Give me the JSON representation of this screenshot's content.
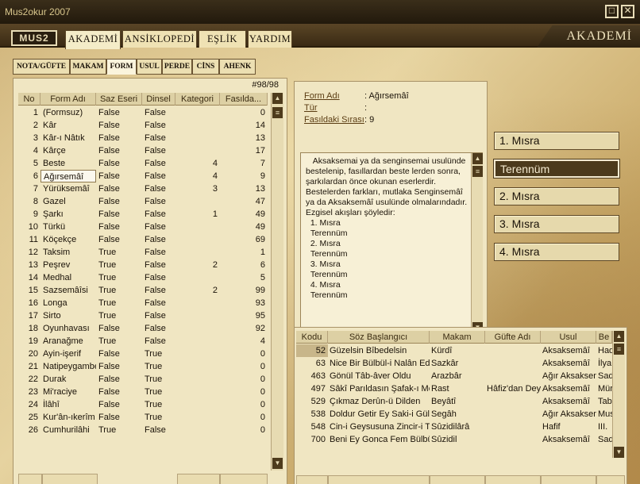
{
  "window": {
    "title": "Mus2okur 2007",
    "max_glyph": "□",
    "close_glyph": "✕"
  },
  "header": {
    "logo": "MUS2",
    "tabs": [
      "AKADEMİ",
      "ANSİKLOPEDİ",
      "EŞLİK",
      "YARDIM"
    ],
    "section_title": "AKADEMİ"
  },
  "subtabs": [
    "NOTA/GÜFTE",
    "MAKAM",
    "FORM",
    "USUL",
    "PERDE",
    "CİNS",
    "AHENK"
  ],
  "form_list": {
    "counter": "#98/98",
    "columns": [
      "No",
      "Form Adı",
      "Saz Eseri",
      "Dinsel",
      "Kategori",
      "Fasılda..."
    ],
    "rows": [
      [
        "1",
        "(Formsuz)",
        "False",
        "False",
        "",
        "0"
      ],
      [
        "2",
        "Kâr",
        "False",
        "False",
        "",
        "14"
      ],
      [
        "3",
        "Kâr-ı Nâtık",
        "False",
        "False",
        "",
        "13"
      ],
      [
        "4",
        "Kârçe",
        "False",
        "False",
        "",
        "17"
      ],
      [
        "5",
        "Beste",
        "False",
        "False",
        "4",
        "7"
      ],
      [
        "6",
        "Ağırsemâî",
        "False",
        "False",
        "4",
        "9"
      ],
      [
        "7",
        "Yürüksemâî",
        "False",
        "False",
        "3",
        "13"
      ],
      [
        "8",
        "Gazel",
        "False",
        "False",
        "",
        "47"
      ],
      [
        "9",
        "Şarkı",
        "False",
        "False",
        "1",
        "49"
      ],
      [
        "10",
        "Türkü",
        "False",
        "False",
        "",
        "49"
      ],
      [
        "11",
        "Köçekçe",
        "False",
        "False",
        "",
        "69"
      ],
      [
        "12",
        "Taksim",
        "True",
        "False",
        "",
        "1"
      ],
      [
        "13",
        "Peşrev",
        "True",
        "False",
        "2",
        "6"
      ],
      [
        "14",
        "Medhal",
        "True",
        "False",
        "",
        "5"
      ],
      [
        "15",
        "Sazsemâîsi",
        "True",
        "False",
        "2",
        "99"
      ],
      [
        "16",
        "Longa",
        "True",
        "False",
        "",
        "93"
      ],
      [
        "17",
        "Sirto",
        "True",
        "False",
        "",
        "95"
      ],
      [
        "18",
        "Oyunhavası",
        "False",
        "False",
        "",
        "92"
      ],
      [
        "19",
        "Aranağme",
        "True",
        "False",
        "",
        "4"
      ],
      [
        "20",
        "Ayin-işerif",
        "False",
        "True",
        "",
        "0"
      ],
      [
        "21",
        "Natipeygambe",
        "False",
        "True",
        "",
        "0"
      ],
      [
        "22",
        "Durak",
        "False",
        "True",
        "",
        "0"
      ],
      [
        "23",
        "Mi'raciye",
        "False",
        "True",
        "",
        "0"
      ],
      [
        "24",
        "İlâhî",
        "False",
        "True",
        "",
        "0"
      ],
      [
        "25",
        "Kur'ân-ıkerîm",
        "False",
        "True",
        "",
        "0"
      ],
      [
        "26",
        "Cumhurilâhi",
        "True",
        "False",
        "",
        "0"
      ]
    ],
    "selected_index": 5
  },
  "form_info": {
    "fields": [
      {
        "label": "Form Adı",
        "value": ": Ağırsemâî"
      },
      {
        "label": "Tür",
        "value": ":"
      },
      {
        "label": "Fasıldaki Sırası",
        "value": ": 9"
      }
    ],
    "description": "   Aksaksemai ya da senginsemai usulünde bestelenip, fasıllardan beste lerden sonra, şarkılardan önce okunan eserlerdir.\nBestelerden farkları, mutlaka Senginsemâî ya da Aksaksemâî usulünde olmalarındadır.\nEzgisel akışları şöyledir:\n  1. Mısra\n  Terennüm\n  2. Mısra\n  Terennüm\n  3. Mısra\n  Terennüm\n  4. Mısra\n  Terennüm"
  },
  "sections": {
    "buttons": [
      "1. Mısra",
      "Terennüm",
      "2. Mısra",
      "3. Mısra",
      "4. Mısra"
    ],
    "active_index": 1
  },
  "works": {
    "columns": [
      "Kodu",
      "Söz Başlangıcı",
      "Makam",
      "Güfte Adı",
      "Usul",
      "Be"
    ],
    "rows": [
      [
        "52",
        "Güzelsin Bîbedelsin",
        "Kürdî",
        "",
        "Aksaksemâî",
        "Had"
      ],
      [
        "63",
        "Nice Bir Bülbül-i Nalân Edey",
        "Sazkâr",
        "",
        "Aksaksemâî",
        "İlya"
      ],
      [
        "463",
        "Gönül Tâb-âver Oldu",
        "Arazbâr",
        "",
        "Ağır Aksaksen",
        "Sad"
      ],
      [
        "497",
        "Sâkî Parıldasın Şafak-ı Mey",
        "Rast",
        "Hâfiz'dan Dey",
        "Aksaksemâî",
        "Mür"
      ],
      [
        "529",
        "Çıkmaz Derûn-ü Dilden",
        "Beyâtî",
        "",
        "Aksaksemâî",
        "Tab"
      ],
      [
        "538",
        "Doldur Getir Ey Saki-i Gülç",
        "Segâh",
        "",
        "Ağır Aksaksen",
        "Mus"
      ],
      [
        "548",
        "Cin-i Geysusuna Zincir-i Te",
        "Sûzidilârâ",
        "",
        "Hafif",
        "III."
      ],
      [
        "700",
        "Beni Ey Gonca Fem Bülbül",
        "Sûzidil",
        "",
        "Aksaksemâî",
        "Sad"
      ]
    ],
    "selected_index": 0
  },
  "colors": {
    "accent_dark": "#4c3a1c",
    "panel": "#f0e6c2",
    "selected_code_bg": "#c8b68a"
  },
  "icons": {
    "scroll_up": "▲",
    "scroll_down": "▼",
    "thumb": "≡"
  }
}
